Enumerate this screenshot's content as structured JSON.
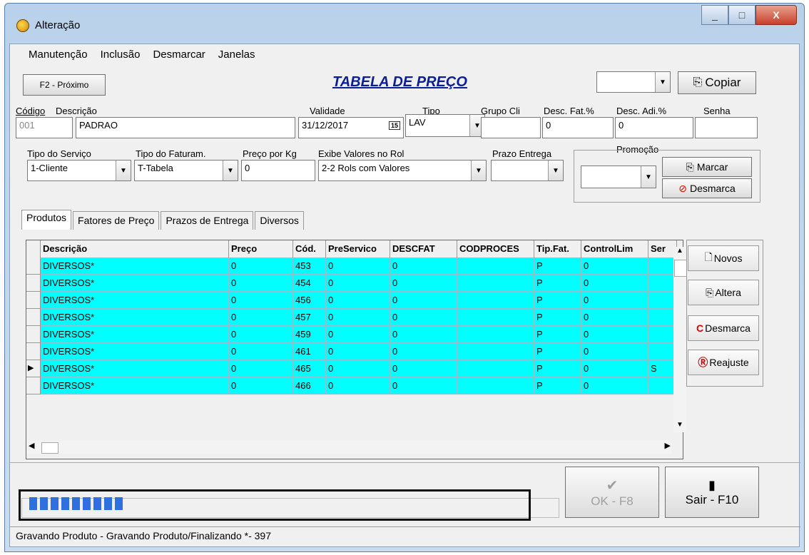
{
  "window": {
    "title": "Alteração",
    "minimize": "_",
    "maximize": "□",
    "close": "X"
  },
  "menu": [
    "Manutenção",
    "Inclusão",
    "Desmarcar",
    "Janelas"
  ],
  "header": {
    "next_button": "F2 - Próximo",
    "page_title": "TABELA DE PREÇO",
    "copy_button": "Copiar",
    "copy_combo_value": ""
  },
  "fields": {
    "codigo_label": "Código",
    "codigo_value": "001",
    "descricao_label": "Descrição",
    "descricao_value": "PADRAO",
    "validade_label": "Validade",
    "validade_value": "31/12/2017",
    "calendar_glyph": "15",
    "tipo_label": "Tipo",
    "tipo_value": "LAV",
    "grupo_cli_label": "Grupo Cli",
    "grupo_cli_value": "",
    "desc_fat_label": "Desc. Fat.%",
    "desc_fat_value": "0",
    "desc_adi_label": "Desc. Adi.%",
    "desc_adi_value": "0",
    "senha_label": "Senha",
    "senha_value": "",
    "tipo_servico_label": "Tipo do Serviço",
    "tipo_servico_value": "1-Cliente",
    "tipo_faturam_label": "Tipo do Faturam.",
    "tipo_faturam_value": "T-Tabela",
    "preco_kg_label": "Preço por Kg",
    "preco_kg_value": "0",
    "exibe_label": "Exibe Valores no Rol",
    "exibe_value": "2-2 Rols com Valores",
    "prazo_label": "Prazo Entrega",
    "prazo_value": "",
    "promocao_label": "Promoção",
    "promocao_value": "",
    "marcar_button": "Marcar",
    "desmarca_button": "Desmarca"
  },
  "tabs": [
    "Produtos",
    "Fatores de Preço",
    "Prazos de Entrega",
    "Diversos"
  ],
  "grid": {
    "columns": [
      "Descrição",
      "Preço",
      "Cód.",
      "PreServico",
      "DESCFAT",
      "CODPROCES",
      "Tip.Fat.",
      "ControlLim",
      "Ser"
    ],
    "rows": [
      [
        "DIVERSOS*",
        "0",
        "453",
        "0",
        "0",
        "",
        "P",
        "0",
        ""
      ],
      [
        "DIVERSOS*",
        "0",
        "454",
        "0",
        "0",
        "",
        "P",
        "0",
        ""
      ],
      [
        "DIVERSOS*",
        "0",
        "456",
        "0",
        "0",
        "",
        "P",
        "0",
        ""
      ],
      [
        "DIVERSOS*",
        "0",
        "457",
        "0",
        "0",
        "",
        "P",
        "0",
        ""
      ],
      [
        "DIVERSOS*",
        "0",
        "459",
        "0",
        "0",
        "",
        "P",
        "0",
        ""
      ],
      [
        "DIVERSOS*",
        "0",
        "461",
        "0",
        "0",
        "",
        "P",
        "0",
        ""
      ],
      [
        "DIVERSOS*",
        "0",
        "465",
        "0",
        "0",
        "",
        "P",
        "0",
        "S"
      ],
      [
        "DIVERSOS*",
        "0",
        "466",
        "0",
        "0",
        "",
        "P",
        "0",
        ""
      ]
    ],
    "current_row": 6
  },
  "side_buttons": [
    "Novos",
    "Altera",
    "Desmarca",
    "Reajuste"
  ],
  "footer": {
    "ok_button": "OK - F8",
    "exit_button": "Sair - F10",
    "progress_segments": 9,
    "status_text": "Gravando Produto - Gravando Produto/Finalizando *- 397"
  }
}
